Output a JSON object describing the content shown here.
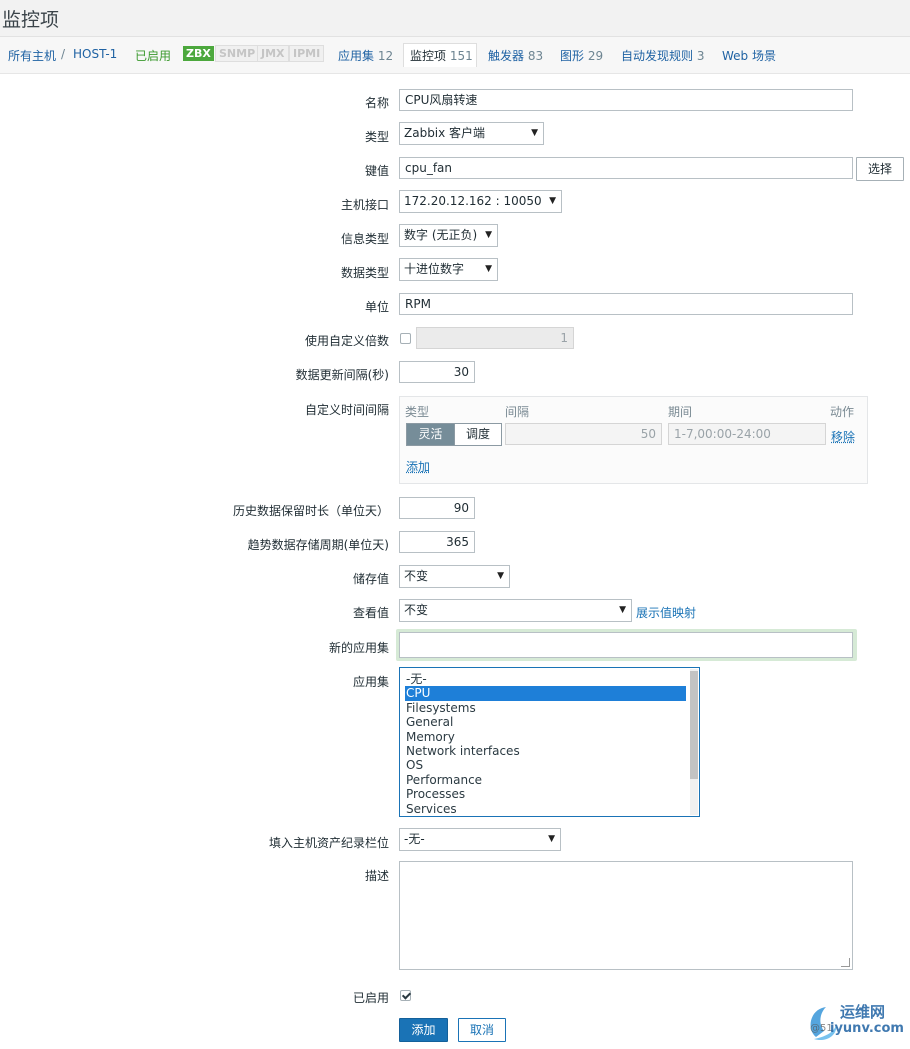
{
  "page": {
    "title": "监控项"
  },
  "nav": {
    "all_hosts": "所有主机",
    "separator": "/",
    "host": "HOST-1",
    "status": "已启用",
    "badges": {
      "zbx": "ZBX",
      "snmp": "SNMP",
      "jmx": "JMX",
      "ipmi": "IPMI"
    },
    "applications": {
      "label": "应用集",
      "count": "12"
    },
    "items": {
      "label": "监控项",
      "count": "151"
    },
    "triggers": {
      "label": "触发器",
      "count": "83"
    },
    "graphs": {
      "label": "图形",
      "count": "29"
    },
    "discovery": {
      "label": "自动发现规则",
      "count": "3"
    },
    "web": {
      "label": "Web 场景"
    }
  },
  "form": {
    "name": {
      "label": "名称",
      "value": "CPU风扇转速"
    },
    "type": {
      "label": "类型",
      "value": "Zabbix 客户端"
    },
    "key": {
      "label": "键值",
      "value": "cpu_fan",
      "select_button": "选择"
    },
    "interface": {
      "label": "主机接口",
      "value": "172.20.12.162 : 10050"
    },
    "info_type": {
      "label": "信息类型",
      "value": "数字 (无正负)"
    },
    "data_type": {
      "label": "数据类型",
      "value": "十进位数字"
    },
    "units": {
      "label": "单位",
      "value": "RPM"
    },
    "multiplier": {
      "label": "使用自定义倍数",
      "checked": false,
      "value": "1"
    },
    "delay": {
      "label": "数据更新间隔(秒)",
      "value": "30"
    },
    "custom_intervals": {
      "label": "自定义时间间隔",
      "headers": {
        "type": "类型",
        "interval": "间隔",
        "period": "期间",
        "action": "动作"
      },
      "row": {
        "flexible": "灵活",
        "scheduling": "调度",
        "interval": "50",
        "period": "1-7,00:00-24:00",
        "remove": "移除"
      },
      "add": "添加"
    },
    "history": {
      "label": "历史数据保留时长（单位天）",
      "value": "90"
    },
    "trends": {
      "label": "趋势数据存储周期(单位天)",
      "value": "365"
    },
    "store_value": {
      "label": "储存值",
      "value": "不变"
    },
    "show_value": {
      "label": "查看值",
      "value": "不变",
      "link": "展示值映射"
    },
    "new_application": {
      "label": "新的应用集",
      "value": ""
    },
    "applications": {
      "label": "应用集",
      "options": [
        "-无-",
        "CPU",
        "Filesystems",
        "General",
        "Memory",
        "Network interfaces",
        "OS",
        "Performance",
        "Processes",
        "Services"
      ],
      "selected": "CPU"
    },
    "inventory": {
      "label": "填入主机资产纪录栏位",
      "value": "-无-"
    },
    "description": {
      "label": "描述",
      "value": ""
    },
    "enabled": {
      "label": "已启用",
      "checked": true
    },
    "buttons": {
      "add": "添加",
      "cancel": "取消"
    }
  },
  "watermark": {
    "text": "运维网",
    "sub": "iyunv.com",
    "prefix": "@51"
  },
  "colors": {
    "link": "#1a73b6",
    "enabled_green": "#3b9a2e",
    "badge_green": "#4ca83d",
    "selected_option": "#1e7fd8"
  }
}
